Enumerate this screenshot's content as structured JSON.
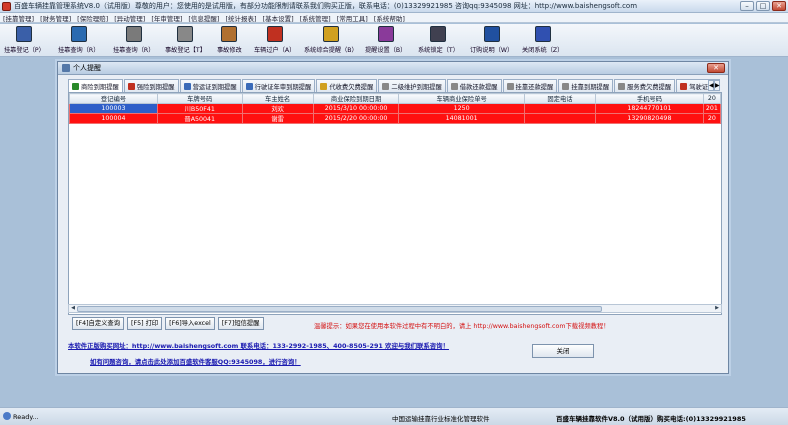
{
  "window": {
    "title": "百盛车辆挂靠管理系统V8.0（试用版）尊敬的用户：您使用的是试用版，有部分功能限制请联系我们购买正版，联系电话：(0)13329921985 咨询qq:9345098 网址：http://www.baishengsoft.com",
    "min": "–",
    "max": "□",
    "close": "✕"
  },
  "menu": [
    "[挂靠管理]",
    "[财务管理]",
    "[保险理赔]",
    "[异动管理]",
    "[年审管理]",
    "[信息提醒]",
    "[统计报表]",
    "[基本设置]",
    "[系统管理]",
    "[常用工具]",
    "[系统帮助]"
  ],
  "toolbar": [
    {
      "label": "挂靠登记（P）",
      "icon": "register-icon",
      "color": "#3a5fa8"
    },
    {
      "label": "挂靠查询（R）",
      "icon": "search-icon",
      "color": "#2a6ab0"
    },
    {
      "label": "挂靠查询（R）",
      "icon": "car-search-icon",
      "color": "#7a7a7a"
    },
    {
      "label": "事故登记【T】",
      "icon": "accident-icon",
      "color": "#888888"
    },
    {
      "label": "事故修改",
      "icon": "edit-icon",
      "color": "#b07030"
    },
    {
      "label": "车辆过户（A）",
      "icon": "transfer-icon",
      "color": "#c03020"
    },
    {
      "label": "系统综合提醒（B）",
      "icon": "reminder-icon",
      "color": "#d0a020"
    },
    {
      "label": "提醒设置（B）",
      "icon": "settings-icon",
      "color": "#8a3a9a"
    },
    {
      "label": "系统锁定（T）",
      "icon": "lock-icon",
      "color": "#404050"
    },
    {
      "label": "订购说明（W）",
      "icon": "info-icon",
      "color": "#2050a0"
    },
    {
      "label": "关闭系统（Z）",
      "icon": "exit-icon",
      "color": "#3050b0"
    }
  ],
  "dialog": {
    "title": "个人提醒",
    "tabs": [
      "商险到期提醒",
      "强险到期提醒",
      "营运证到期提醒",
      "行驶证年审到期提醒",
      "代收费欠费提醒",
      "二级维护到期提醒",
      "借款还款提醒",
      "挂靠还款提醒",
      "挂靠到期提醒",
      "服务费欠费提醒",
      "驾驶证年审到"
    ],
    "tab_colors": [
      "#2a8a2a",
      "#c03020",
      "#3a6ab8",
      "#3a6ab8",
      "#d0a020",
      "#888888",
      "#888888",
      "#888888",
      "#888888",
      "#888888",
      "#c03020"
    ],
    "table": {
      "headers": [
        "登记编号",
        "车牌号码",
        "车主姓名",
        "商业保险到期日期",
        "车辆商业保险单号",
        "固定电话",
        "手机号码",
        "20"
      ],
      "rows": [
        [
          "100003",
          "川B50F41",
          "刘欢",
          "2015/3/10 00:00:00",
          "1250",
          "",
          "18244770101",
          "201"
        ],
        [
          "100004",
          "晋A50041",
          "谢雷",
          "2015/2/20 00:00:00",
          "14081001",
          "",
          "13290820498",
          "20"
        ]
      ]
    },
    "buttons": [
      "[F4]自定义查询",
      "[F5] 打印",
      "[F6]导入excel",
      "[F7]短信提醒"
    ],
    "notice": "温馨提示：如果您在使用本软件过程中有不明白的，请上 http://www.baishengsoft.com下载视频教程！",
    "info1": "本软件正版购买网址：http://www.baishengsoft.com  联系电话：133-2992-1985、400-8505-291 欢迎与我们联系咨询！",
    "info2": "如有问题咨询，请点击此处添加百盛软件客服QQ:9345098，进行咨询！",
    "close": "关闭"
  },
  "status": {
    "ready": "Ready...",
    "center": "中国运输挂靠行业标准化管理软件",
    "right": "百盛车辆挂靠软件V8.0（试用版）购买电话:(0)13329921985"
  }
}
